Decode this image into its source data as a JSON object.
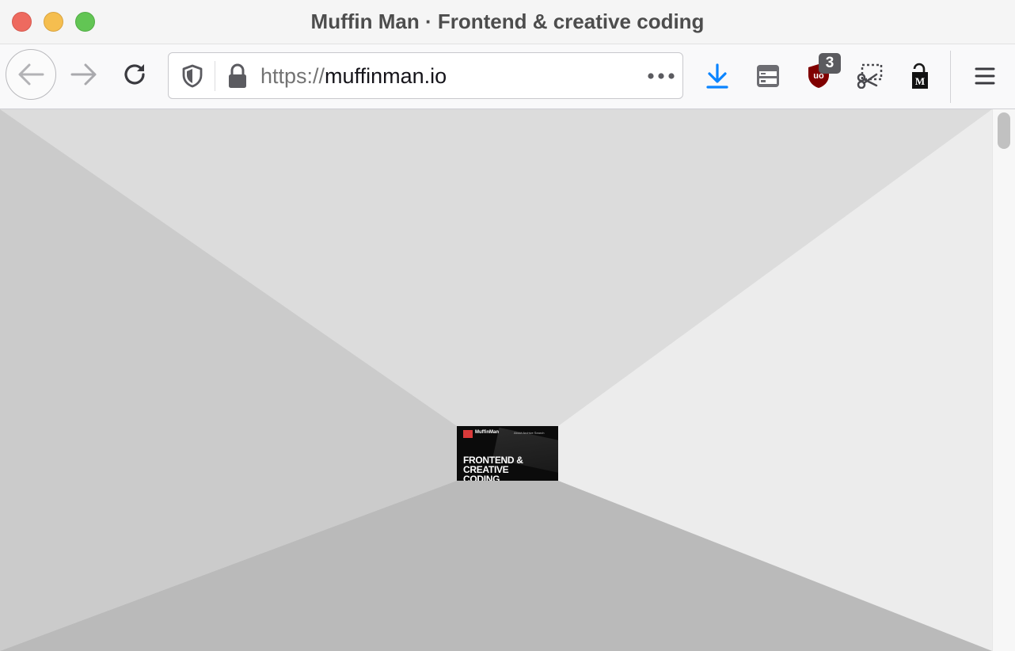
{
  "window": {
    "title": "Muffin Man · Frontend & creative coding"
  },
  "toolbar": {
    "back_icon": "arrow-left-icon",
    "forward_icon": "arrow-right-icon",
    "reload_icon": "reload-icon",
    "url": {
      "scheme": "https://",
      "host": "muffinman.io"
    },
    "extensions": [
      {
        "name": "download-icon",
        "color": "#0a84ff"
      },
      {
        "name": "server-icon"
      },
      {
        "name": "ublock-origin-icon",
        "badge": "3",
        "color": "#800000"
      },
      {
        "name": "scissors-screenshot-icon"
      },
      {
        "name": "mercury-reader-lock-icon"
      }
    ],
    "menu_icon": "hamburger-menu-icon"
  },
  "page": {
    "thumbnail": {
      "brand": "MuffinMan",
      "nav": "About  Archive  Search",
      "heading": "FRONTEND & CREATIVE CODING"
    },
    "colors": {
      "top": "#dcdcdc",
      "left": "#cbcbcb",
      "right": "#ececec",
      "bottom": "#bababa"
    }
  }
}
